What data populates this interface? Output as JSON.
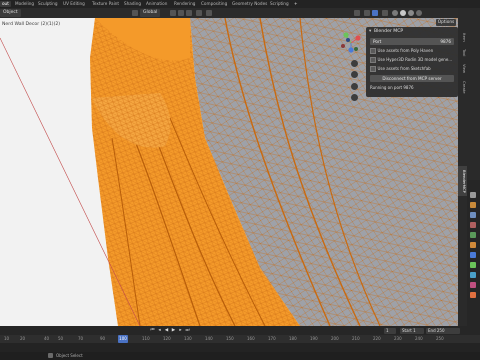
{
  "topbar": {
    "tabs": [
      "Layout",
      "Modeling",
      "Sculpting",
      "UV Editing",
      "Texture Paint",
      "Shading",
      "Animation",
      "Rendering",
      "Compositing",
      "Geometry Nodes",
      "Scripting"
    ],
    "active_index": 0,
    "active_label": "out"
  },
  "header": {
    "mode_label": "Object",
    "transform_label": "Global",
    "options_label": "Options"
  },
  "viewport": {
    "title": "Nerd Wall Decor (2)(1)(2)",
    "background": "#f2f2f2",
    "mesh_color": "#f49a2a",
    "wire_color": "#c96a10"
  },
  "mcp_panel": {
    "title": "Blender MCP",
    "port_label": "Port",
    "port_value": "9876",
    "options": [
      "Use assets from Poly Haven",
      "Use Hyper3D Rodin 3D model gene...",
      "Use assets from Sketchfab"
    ],
    "disconnect_label": "Disconnect from MCP server",
    "status": "Running on port 9876"
  },
  "side_tabs": [
    "Item",
    "Tool",
    "View",
    "Create",
    "BlenderMCP"
  ],
  "side_active": "BlenderMCP",
  "timeline": {
    "start_label": "Start",
    "start_value": "1",
    "end_label": "End",
    "end_value": "250",
    "current_frame": "1",
    "ruler": [
      "10",
      "20",
      "40",
      "50",
      "70",
      "90",
      "100",
      "110",
      "120",
      "130",
      "140",
      "150",
      "160",
      "170",
      "180",
      "190",
      "200",
      "210",
      "220",
      "230",
      "240",
      "250"
    ]
  },
  "statusbar": {
    "hint": "Object Select"
  }
}
